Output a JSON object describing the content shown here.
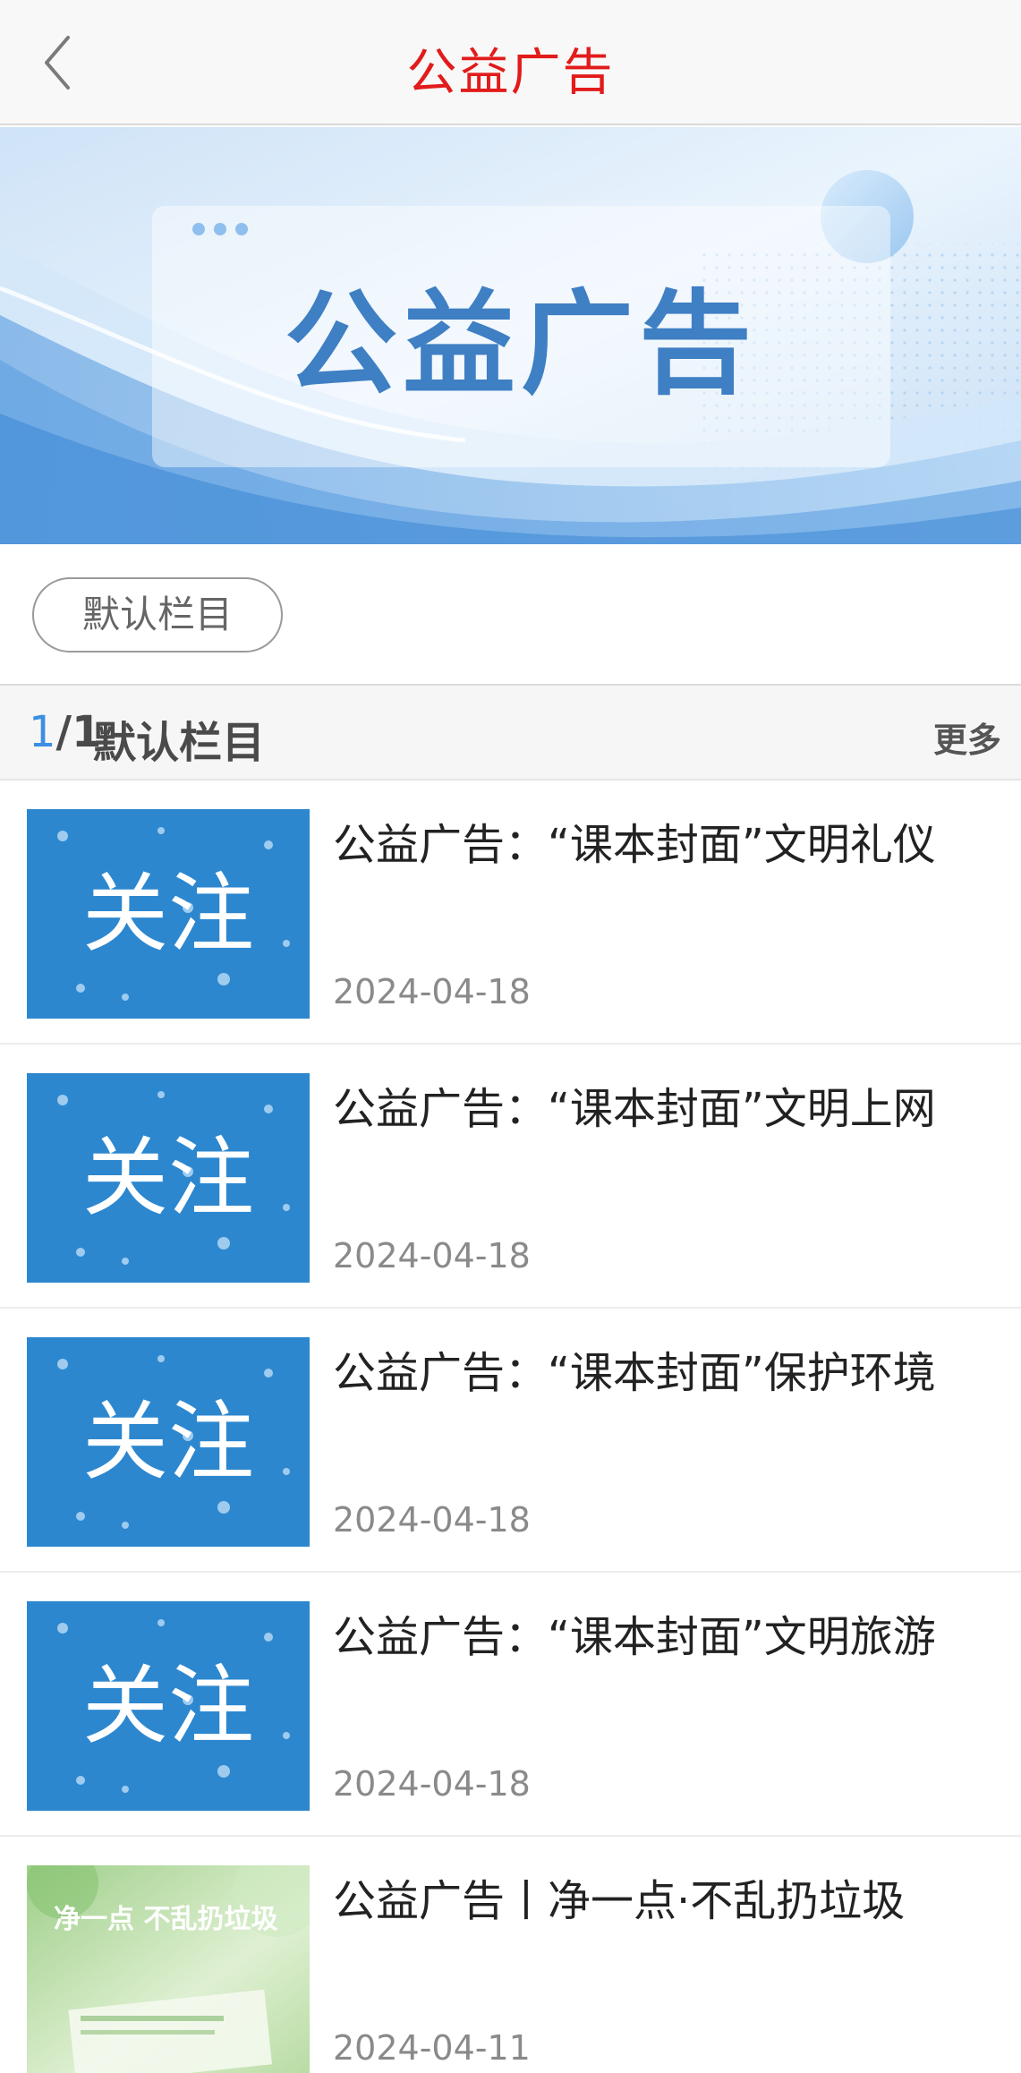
{
  "header": {
    "title": "公益广告",
    "back_icon": "chevron-left-icon"
  },
  "banner": {
    "text": "公益广告",
    "colors": {
      "primary": "#3f7fc4",
      "light": "#dcecfb"
    }
  },
  "categories": {
    "chips": [
      "默认栏目"
    ]
  },
  "section": {
    "page_current": "1",
    "page_rest": "/1",
    "title": "默认栏目",
    "more_label": "更多"
  },
  "list": {
    "items": [
      {
        "title": "公益广告：“课本封面”文明礼仪",
        "date": "2024-04-18",
        "thumb_text": "关注"
      },
      {
        "title": "公益广告：“课本封面”文明上网",
        "date": "2024-04-18",
        "thumb_text": "关注"
      },
      {
        "title": "公益广告：“课本封面”保护环境",
        "date": "2024-04-18",
        "thumb_text": "关注"
      },
      {
        "title": "公益广告：“课本封面”文明旅游",
        "date": "2024-04-18",
        "thumb_text": "关注"
      },
      {
        "title": "公益广告丨净一点·不乱扔垃圾",
        "date": "2024-04-11",
        "thumb_text": "净一点 不乱扔垃圾"
      }
    ]
  },
  "colors": {
    "accent_red": "#e21b1b",
    "page_blue": "#3c8fe0",
    "thumb_blue": "#1d78c4"
  }
}
